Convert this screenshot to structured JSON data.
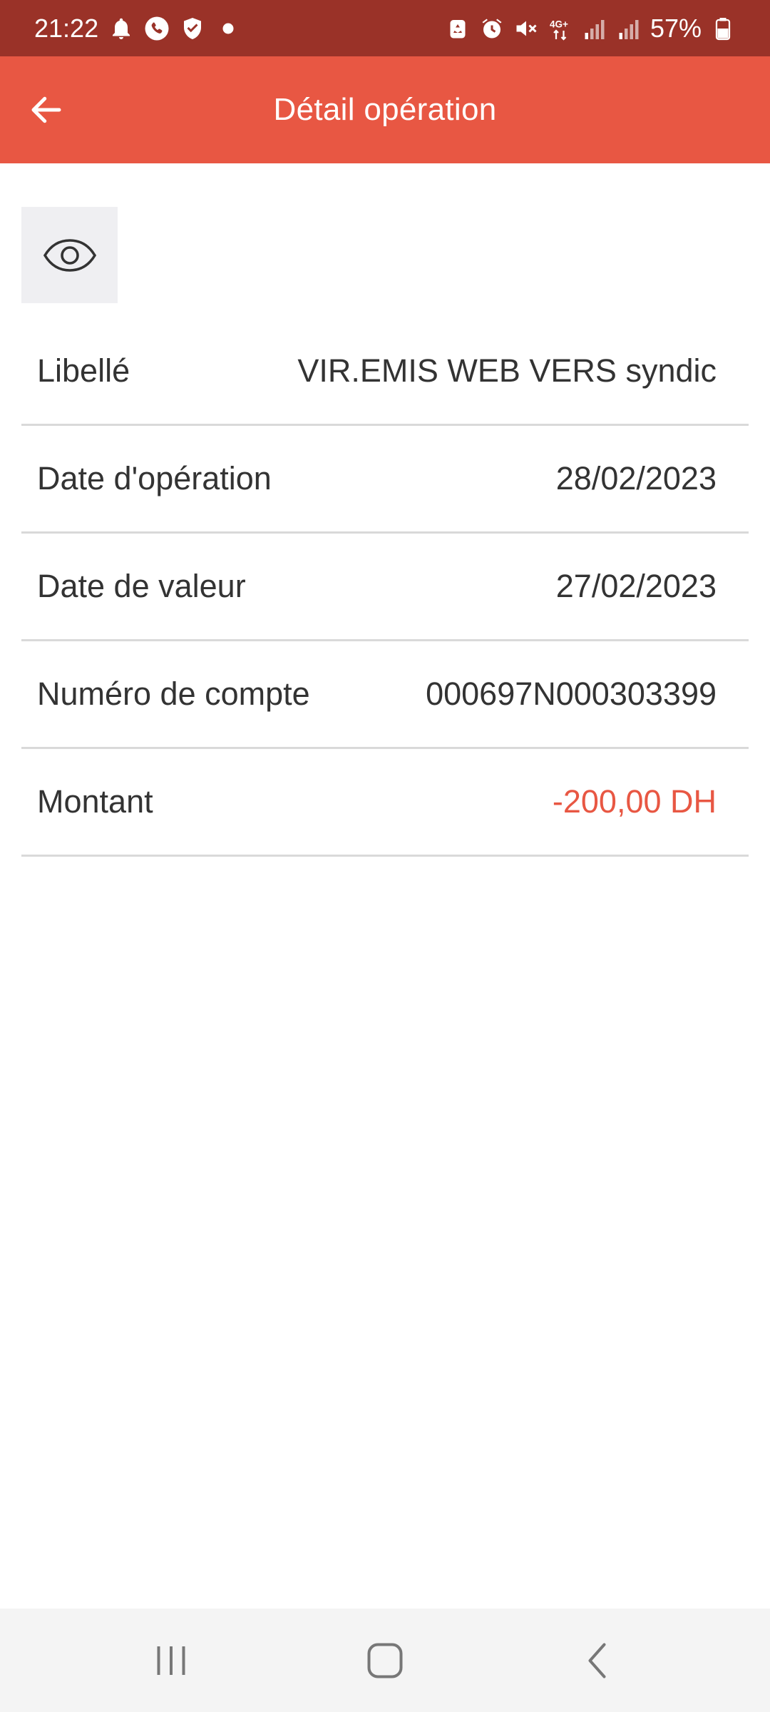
{
  "status_bar": {
    "time": "21:22",
    "network": "4G+",
    "battery": "57%",
    "left_icons": [
      "bell-icon",
      "phone-icon",
      "shield-icon",
      "dot-icon"
    ],
    "right_icons": [
      "recycle-icon",
      "alarm-icon",
      "mute-icon",
      "network-4g-icon",
      "signal-icon",
      "signal-icon",
      "battery-icon"
    ]
  },
  "header": {
    "title": "Détail opération",
    "back_icon": "arrow-left-icon",
    "background": "#e85743"
  },
  "visibility_toggle": {
    "icon": "eye-icon"
  },
  "details": [
    {
      "label": "Libellé",
      "value": "VIR.EMIS WEB VERS syndic"
    },
    {
      "label": "Date d'opération",
      "value": "28/02/2023"
    },
    {
      "label": "Date de valeur",
      "value": "27/02/2023"
    },
    {
      "label": "Numéro de compte",
      "value": "000697N000303399"
    },
    {
      "label": "Montant",
      "value": "-200,00 DH",
      "color": "#e85743"
    }
  ],
  "nav_bar": {
    "buttons": [
      "recent-apps-icon",
      "home-icon",
      "back-icon"
    ]
  }
}
